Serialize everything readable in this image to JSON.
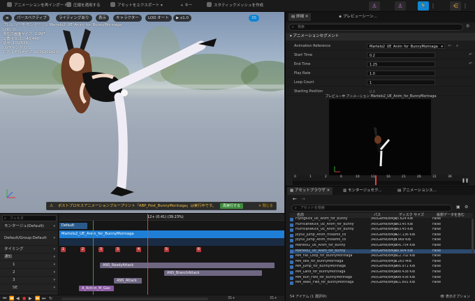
{
  "toolbar": {
    "reimport": "アニメーションを再インポート",
    "apply_compression": "圧縮を適用する",
    "export_asset": "アセットをエクスポート",
    "key": "キー",
    "create_static_mesh": "スタティックメッシュを作成"
  },
  "viewport": {
    "chips": [
      "パースペクティブ",
      "ライティングあり",
      "表示",
      "キャラクター",
      "LOD オート",
      "x1.0"
    ],
    "chip_right": "35",
    "info_lines": [
      "プレビュー中 モンタージュ Martelo2_UE_Anim_for_BunnyMorinaga",
      "LOD: 0",
      "現在の画面サイズ: 1.997",
      "三角ポリゴン 43,448",
      "頂点: 109,626",
      "UVチャンネル: 1",
      "おおよそのサイズ: 200x200x200"
    ],
    "notice_text": "ポストプロセスアニメーションブループリント「ABP_Post_BunnyMorinaga」は実行中です。",
    "notice_apply": "再実行する",
    "notice_close": "✕ 閉じる"
  },
  "timeline": {
    "filter_placeholder": "フィルタ",
    "rows": [
      {
        "label": "モンタージュ(Default)"
      },
      {
        "label": "Default/Group:Default"
      },
      {
        "label": "タイミング"
      },
      {
        "label": "通知"
      },
      {
        "label": "1"
      },
      {
        "label": "2"
      },
      {
        "label": "3"
      },
      {
        "label": "SE"
      }
    ],
    "playhead_label": "12+ (0.41) (39.23%)",
    "section_label": "Default",
    "segment_label": "Martelo2_UE_Anim_for_BunnyMorinaga",
    "timing_markers": [
      "1",
      "2",
      "3",
      "4",
      "5",
      "6"
    ],
    "notifies": [
      "ANS_ReadyAttack",
      "ANS_BranchAttack",
      "ANS_Attack",
      "A_Action_M_Gas"
    ],
    "frame_end": "31+",
    "frame_end2": "31+"
  },
  "details": {
    "tabs": [
      "詳細",
      "プレビューシーン..."
    ],
    "search_placeholder": "検索",
    "section": "アニメーションセグメント",
    "props": [
      {
        "label": "Animation Reference",
        "value": "Martelo2_UE_Anim_for_BunnyMorinaga"
      },
      {
        "label": "Start Time",
        "value": "0.2"
      },
      {
        "label": "End Time",
        "value": "1.25"
      },
      {
        "label": "Play Rate",
        "value": "1.0"
      },
      {
        "label": "Loop Count",
        "value": "1"
      },
      {
        "label": "Starting Position",
        "value": "0.0"
      }
    ],
    "preview_title": "プレビュー中 アニメーション Martelo2_UE_Anim_for_BunnyMorinaga",
    "preview_ticks": [
      "0",
      "1",
      "2",
      "6",
      "10",
      "13",
      "16",
      "21",
      "26",
      "31",
      "36"
    ]
  },
  "assets": {
    "tabs": [
      "アセットブラウザ",
      "モンタージュセク...",
      "アニメーションス..."
    ],
    "search_placeholder": "アセットを検索",
    "columns": [
      "名前",
      "パス",
      "ディスク サイズ",
      "仮想データを含む"
    ],
    "rows": [
      {
        "name": "FlyingKick_UE_Anim_for_Bunny",
        "path": "/All/Game/BMJU",
        "size": "15.624 KiB",
        "virtual": "False"
      },
      {
        "name": "HurricaneKick_UE_Anim_for_Bunny",
        "path": "/All/Game/BMJU",
        "size": "163.45 KiB",
        "virtual": "False"
      },
      {
        "name": "HurricaneKick_UE_Anim_for_Bunny",
        "path": "/All/Game/BMJU",
        "size": "163.45 KiB",
        "virtual": "False"
      },
      {
        "name": "Joyful_Jump_Anim_mixamo_co",
        "path": "/All/Game/BMJU",
        "size": "427.136 KiB",
        "virtual": "False"
      },
      {
        "name": "Joyful_Jump_Anim_mixamo_co",
        "path": "/All/Game/BMJU",
        "size": "8.969 KiB",
        "virtual": "False"
      },
      {
        "name": "Martelo2_UE_Anim_for_Bunny",
        "path": "/All/Game/BMJU",
        "size": "356.754 KiB",
        "virtual": "False"
      },
      {
        "name": "Martelo2_UE_Anim_for_Bunny",
        "path": "/All/Game/BMJU",
        "size": "19.904 KiB",
        "virtual": "False"
      },
      {
        "name": "MM_Fall_Loop_for_BunnyMorinaga",
        "path": "/All/Game/BMJU",
        "size": "512.702 KiB",
        "virtual": "False"
      },
      {
        "name": "MM_Idle_for_BunnyMorinaga",
        "path": "/All/Game/BMJU",
        "size": "1.263 MiB",
        "virtual": "False"
      },
      {
        "name": "MM_Jump_for_BunnyMorinaga",
        "path": "/All/Game/BMJU",
        "size": "266.971 KiB",
        "virtual": "False"
      },
      {
        "name": "MM_Land_for_BunnyMorinaga",
        "path": "/All/Game/BMJU",
        "size": "298.438 KiB",
        "virtual": "False"
      },
      {
        "name": "MM_Run_Fwd_for_BunnyMorinaga",
        "path": "/All/Game/BMJU",
        "size": "298.438 KiB",
        "virtual": "False"
      },
      {
        "name": "MM_Walk_Fwd_for_BunnyMorinaga",
        "path": "/All/Game/BMJU",
        "size": "311.891 KiB",
        "virtual": "False"
      }
    ],
    "selected_index": 6,
    "status": "54 アイテム (1 選択中)"
  },
  "colors": {
    "accent": "#0e86d4",
    "section_bar": "#1f7fd6",
    "notify_marker": "#b43a3a",
    "selected_row": "#2b4a6e",
    "warning_text": "#f0c040"
  }
}
